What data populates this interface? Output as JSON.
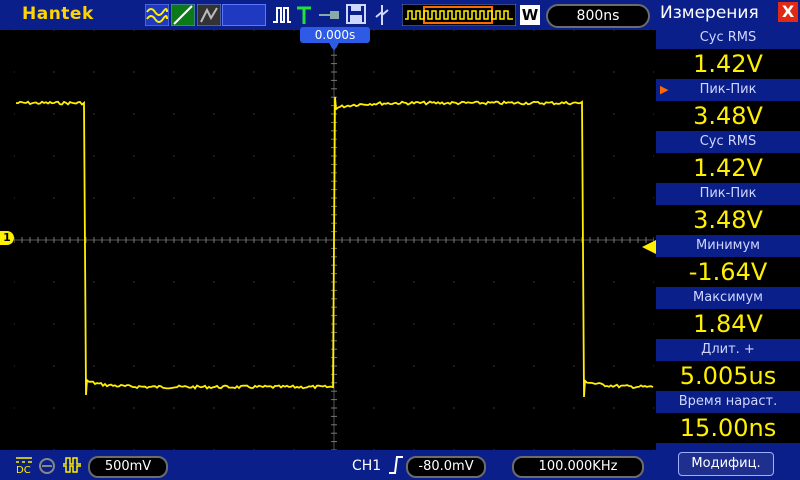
{
  "topbar": {
    "brand": "Hantek",
    "timebase": "800ns",
    "memory_mode_icon": "W"
  },
  "screen": {
    "trigger_position": "0.000s",
    "channel_marker": "1",
    "waveform_color": "#ffef00"
  },
  "panel": {
    "title": "Измерения",
    "close": "X",
    "measurements": [
      {
        "label": "Сус RMS",
        "value": "1.42V",
        "selected": false
      },
      {
        "label": "Пик-Пик",
        "value": "3.48V",
        "selected": true
      },
      {
        "label": "Сус  RMS",
        "value": "1.42V",
        "selected": false
      },
      {
        "label": "Пик-Пик",
        "value": "3.48V",
        "selected": false
      },
      {
        "label": "Минимум",
        "value": "-1.64V",
        "selected": false
      },
      {
        "label": "Максимум",
        "value": "1.84V",
        "selected": false
      },
      {
        "label": "Длит.  +",
        "value": "5.005us",
        "selected": false
      },
      {
        "label": "Время  нараст.",
        "value": "15.00ns",
        "selected": false
      }
    ],
    "modify_button": "Модифиц."
  },
  "bottombar": {
    "coupling": "DC",
    "volts_div": "500mV",
    "channel": "CH1",
    "trigger_level": "-80.0mV",
    "frequency": "100.000KHz"
  }
}
